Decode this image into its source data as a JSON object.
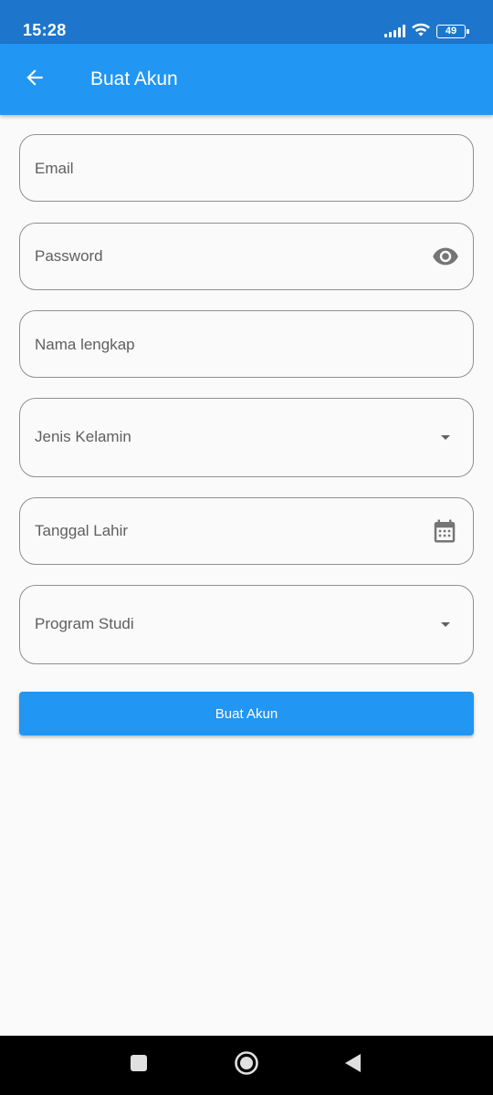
{
  "status_bar": {
    "time": "15:28",
    "battery": "49",
    "icons": [
      "signal-icon",
      "wifi-icon",
      "battery-icon"
    ]
  },
  "app_bar": {
    "title": "Buat Akun",
    "back_icon": "arrow-left-icon",
    "background": "#2196f3"
  },
  "form": {
    "email": {
      "label": "Email"
    },
    "password": {
      "label": "Password",
      "icon": "eye-icon"
    },
    "full_name": {
      "label": "Nama lengkap"
    },
    "gender": {
      "label": "Jenis Kelamin",
      "icon": "dropdown-arrow-icon"
    },
    "birth_date": {
      "label": "Tanggal Lahir",
      "icon": "calendar-icon"
    },
    "study_program": {
      "label": "Program Studi",
      "icon": "dropdown-arrow-icon"
    },
    "submit_label": "Buat Akun"
  },
  "nav_bar": {
    "buttons": [
      "recent-apps-icon",
      "home-icon",
      "back-triangle-icon"
    ]
  },
  "colors": {
    "primary": "#2196f3",
    "status_bar": "#1e76cc",
    "field_border": "#8f8f8f",
    "label_text": "#5f5f5f"
  }
}
